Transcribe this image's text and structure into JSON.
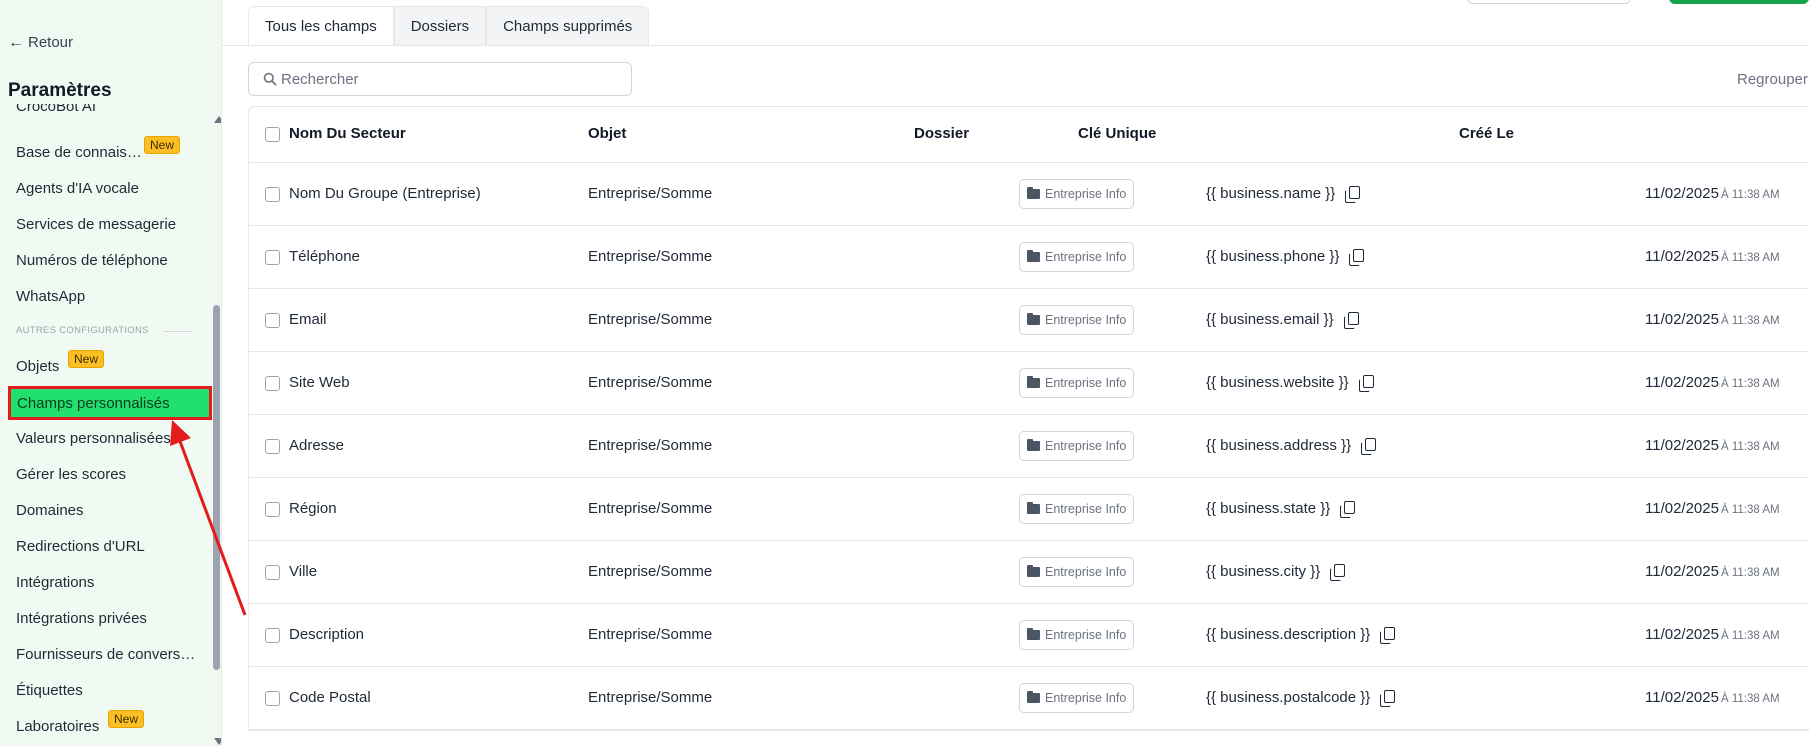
{
  "sidebar": {
    "back_label": "Retour",
    "title": "Paramètres",
    "items": [
      {
        "label": "CrocoBot AI"
      },
      {
        "label": "Base de connais…",
        "badge": "New"
      },
      {
        "label": "Agents d'IA vocale"
      },
      {
        "label": "Services de messagerie"
      },
      {
        "label": "Numéros de téléphone"
      },
      {
        "label": "WhatsApp"
      },
      {
        "label": "Objets",
        "badge": "New"
      },
      {
        "label": "Champs personnalisés"
      },
      {
        "label": "Valeurs personnalisées"
      },
      {
        "label": "Gérer les scores"
      },
      {
        "label": "Domaines"
      },
      {
        "label": "Redirections d'URL"
      },
      {
        "label": "Intégrations"
      },
      {
        "label": "Intégrations privées"
      },
      {
        "label": "Fournisseurs de convers…"
      },
      {
        "label": "Étiquettes"
      },
      {
        "label": "Laboratoires",
        "badge": "New"
      }
    ],
    "section_label": "AUTRES CONFIGURATIONS"
  },
  "tabs": [
    "Tous les champs",
    "Dossiers",
    "Champs supprimés"
  ],
  "search": {
    "placeholder": "Rechercher"
  },
  "regroup_label": "Regrouper",
  "table": {
    "headers": [
      "Nom Du Secteur",
      "Objet",
      "Dossier",
      "Clé Unique",
      "Créé Le"
    ],
    "rows": [
      {
        "name": "Nom Du Groupe (Entreprise)",
        "object": "Entreprise/Somme",
        "folder": "Entreprise Info",
        "key": "{{ business.name }}",
        "date": "11/02/2025",
        "time": "À 11:38 AM"
      },
      {
        "name": "Téléphone",
        "object": "Entreprise/Somme",
        "folder": "Entreprise Info",
        "key": "{{ business.phone }}",
        "date": "11/02/2025",
        "time": "À 11:38 AM"
      },
      {
        "name": "Email",
        "object": "Entreprise/Somme",
        "folder": "Entreprise Info",
        "key": "{{ business.email }}",
        "date": "11/02/2025",
        "time": "À 11:38 AM"
      },
      {
        "name": "Site Web",
        "object": "Entreprise/Somme",
        "folder": "Entreprise Info",
        "key": "{{ business.website }}",
        "date": "11/02/2025",
        "time": "À 11:38 AM"
      },
      {
        "name": "Adresse",
        "object": "Entreprise/Somme",
        "folder": "Entreprise Info",
        "key": "{{ business.address }}",
        "date": "11/02/2025",
        "time": "À 11:38 AM"
      },
      {
        "name": "Région",
        "object": "Entreprise/Somme",
        "folder": "Entreprise Info",
        "key": "{{ business.state }}",
        "date": "11/02/2025",
        "time": "À 11:38 AM"
      },
      {
        "name": "Ville",
        "object": "Entreprise/Somme",
        "folder": "Entreprise Info",
        "key": "{{ business.city }}",
        "date": "11/02/2025",
        "time": "À 11:38 AM"
      },
      {
        "name": "Description",
        "object": "Entreprise/Somme",
        "folder": "Entreprise Info",
        "key": "{{ business.description }}",
        "date": "11/02/2025",
        "time": "À 11:38 AM"
      },
      {
        "name": "Code Postal",
        "object": "Entreprise/Somme",
        "folder": "Entreprise Info",
        "key": "{{ business.postalcode }}",
        "date": "11/02/2025",
        "time": "À 11:38 AM"
      }
    ]
  },
  "icons": {
    "back": "arrow-left-icon",
    "search": "search-icon",
    "folder": "folder-icon",
    "copy": "copy-icon"
  },
  "colors": {
    "active_item_bg": "#22e06f",
    "highlight_border": "#e31b1b",
    "badge_bg": "#fbbf24",
    "primary_green": "#16a34a"
  }
}
